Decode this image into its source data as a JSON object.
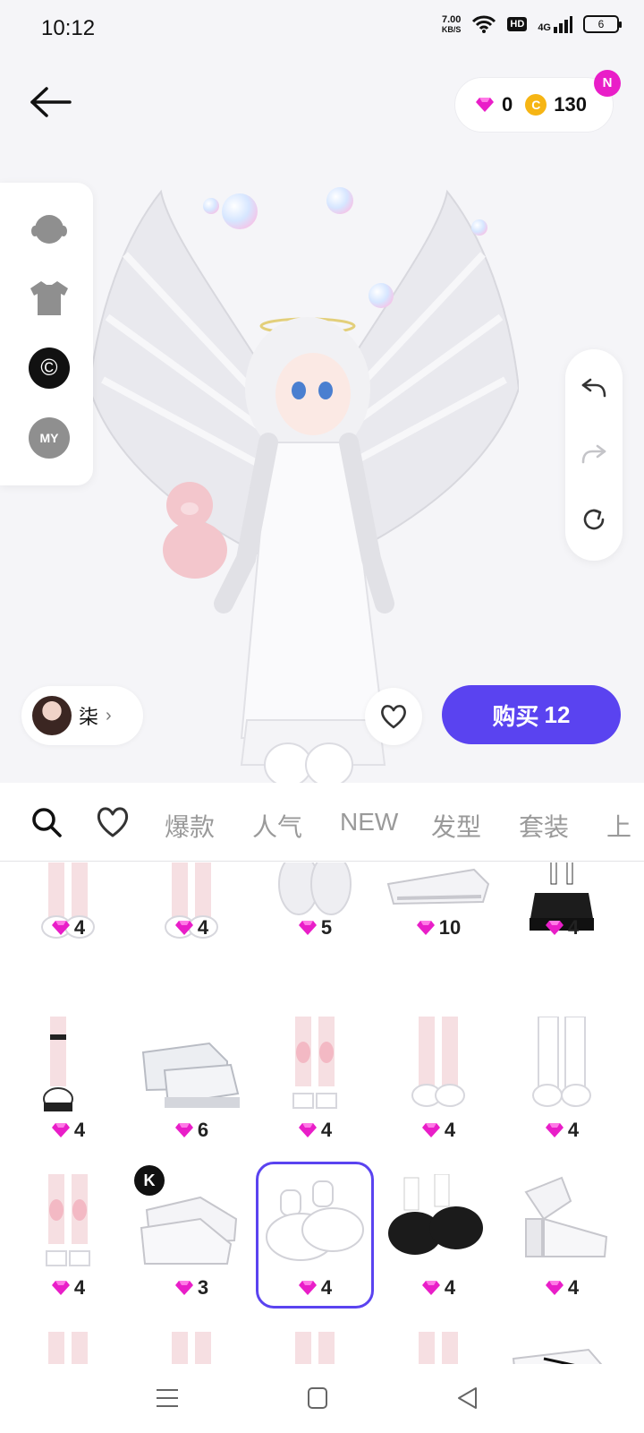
{
  "status_bar": {
    "time": "10:12",
    "net_speed_value": "7.00",
    "net_speed_unit": "KB/S",
    "hd_label": "HD",
    "network_label": "4G",
    "battery_level": "6"
  },
  "header": {
    "gems": "0",
    "coin_symbol": "C",
    "coins": "130",
    "notification_badge": "N"
  },
  "left_panel": {
    "my_label": "MY",
    "c_label": "©"
  },
  "profile": {
    "name": "柒"
  },
  "buy_button": {
    "label": "购买",
    "count": "12"
  },
  "tabs": [
    "爆款",
    "人气",
    "NEW",
    "发型",
    "套装",
    "上"
  ],
  "items": [
    {
      "price": "4",
      "kind": "legs-white-platform"
    },
    {
      "price": "4",
      "kind": "legs-white-platform"
    },
    {
      "price": "5",
      "kind": "fluffy-boots"
    },
    {
      "price": "10",
      "kind": "sneaker"
    },
    {
      "price": "4",
      "kind": "black-platform"
    },
    {
      "price": "4",
      "kind": "legs-black-platform"
    },
    {
      "price": "6",
      "kind": "chunky-loafers"
    },
    {
      "price": "4",
      "kind": "legs-pink"
    },
    {
      "price": "4",
      "kind": "legs-white-shoes"
    },
    {
      "price": "4",
      "kind": "white-tall-boots"
    },
    {
      "price": "4",
      "kind": "legs-pink"
    },
    {
      "price": "3",
      "kind": "white-sneakers",
      "badge": "K"
    },
    {
      "price": "4",
      "kind": "white-velcro-shoes",
      "selected": true
    },
    {
      "price": "4",
      "kind": "black-mary-janes"
    },
    {
      "price": "4",
      "kind": "white-heels"
    },
    {
      "price": "",
      "kind": "legs"
    },
    {
      "price": "",
      "kind": "legs"
    },
    {
      "price": "",
      "kind": "legs"
    },
    {
      "price": "",
      "kind": "legs"
    },
    {
      "price": "",
      "kind": "white-loafers"
    }
  ],
  "colors": {
    "accent": "#5a43f0",
    "gem": "#e91ec8",
    "coin": "#f6b514"
  }
}
